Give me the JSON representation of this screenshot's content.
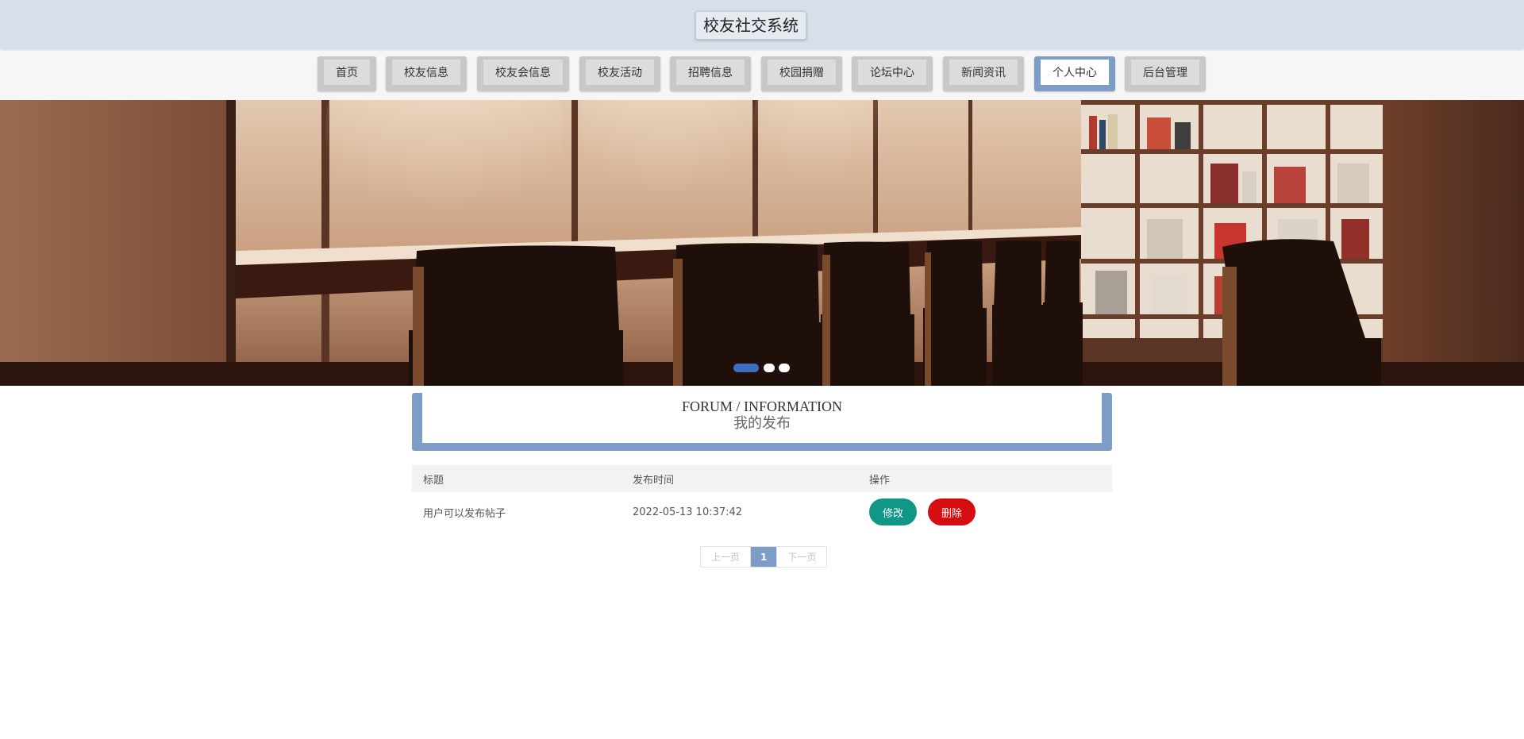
{
  "header": {
    "title": "校友社交系统"
  },
  "nav": {
    "items": [
      {
        "label": "首页"
      },
      {
        "label": "校友信息"
      },
      {
        "label": "校友会信息"
      },
      {
        "label": "校友活动"
      },
      {
        "label": "招聘信息"
      },
      {
        "label": "校园捐赠"
      },
      {
        "label": "论坛中心"
      },
      {
        "label": "新闻资讯"
      },
      {
        "label": "个人中心",
        "active": true
      },
      {
        "label": "后台管理"
      }
    ]
  },
  "banner": {
    "slide_count": 3,
    "active_slide": 1
  },
  "section": {
    "title_en_left": "FORUM",
    "title_sep": "/",
    "title_en_right": "INFORMATION",
    "title_cn": "我的发布"
  },
  "table": {
    "headers": [
      "标题",
      "发布时间",
      "操作"
    ],
    "rows": [
      {
        "title": "用户可以发布帖子",
        "time": "2022-05-13 10:37:42",
        "edit": "修改",
        "delete": "删除"
      }
    ]
  },
  "pagination": {
    "prev": "上一页",
    "current": "1",
    "next": "下一页"
  },
  "colors": {
    "accent": "#7c9dc6",
    "edit": "#129688",
    "delete": "#d50d10",
    "header_bg": "#d7e0ea"
  }
}
